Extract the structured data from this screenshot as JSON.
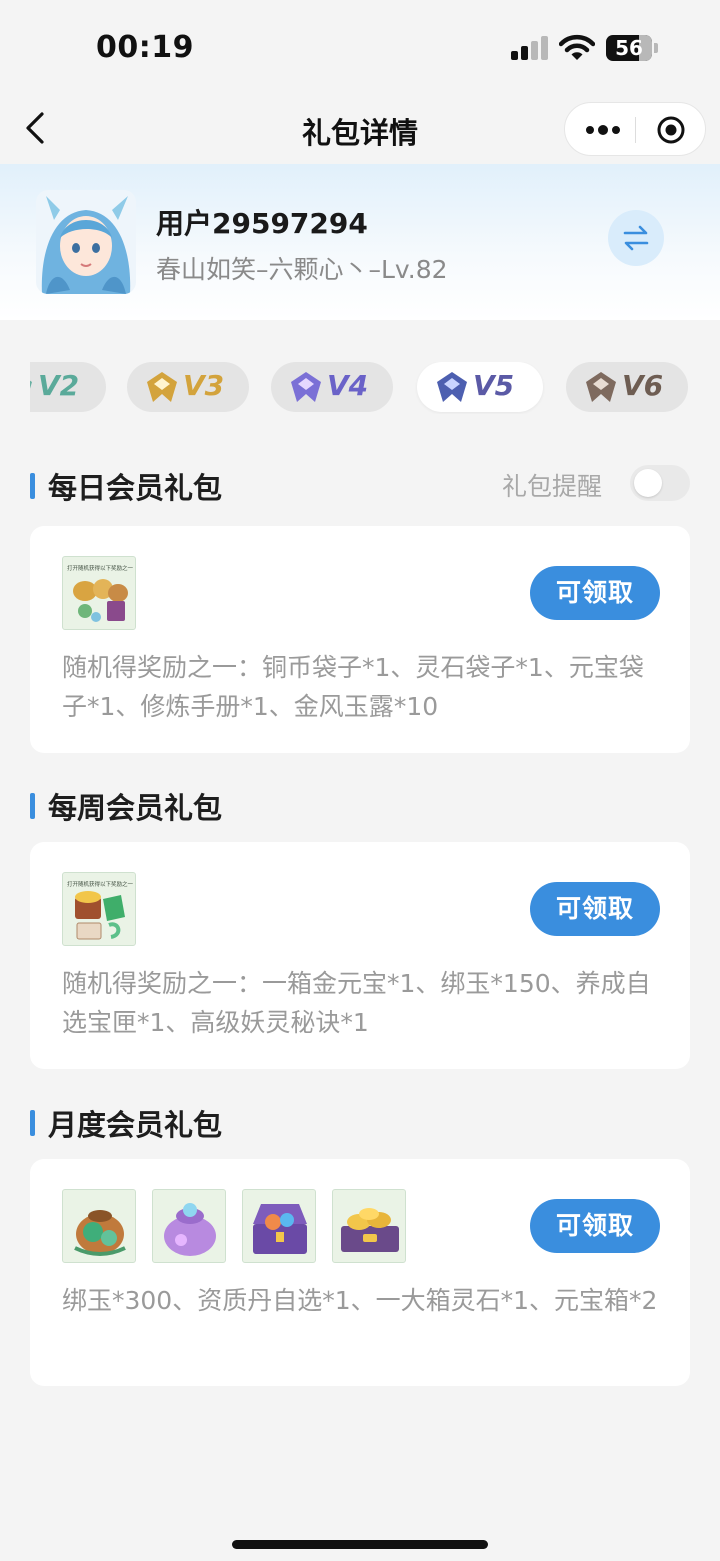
{
  "status_bar": {
    "time": "00:19",
    "battery": "56"
  },
  "nav": {
    "title": "礼包详情"
  },
  "user": {
    "name": "用户29597294",
    "server_role": "春山如笑–六颗心丶–Lv.82"
  },
  "levels": [
    {
      "label": "V2",
      "color": "#5aaa9a"
    },
    {
      "label": "V3",
      "color": "#d3a33c"
    },
    {
      "label": "V4",
      "color": "#6a62c8"
    },
    {
      "label": "V5",
      "color": "#5b5aa6",
      "selected": true
    },
    {
      "label": "V6",
      "color": "#6e5d52"
    }
  ],
  "sections": {
    "daily": {
      "title": "每日会员礼包",
      "remind_label": "礼包提醒",
      "remind_on": false,
      "icon_caption": "打开随机获得以下奖励之一",
      "claim_label": "可领取",
      "description": "随机得奖励之一：铜币袋子*1、灵石袋子*1、元宝袋子*1、修炼手册*1、金风玉露*10"
    },
    "weekly": {
      "title": "每周会员礼包",
      "icon_caption": "打开随机获得以下奖励之一",
      "claim_label": "可领取",
      "description": "随机得奖励之一：一箱金元宝*1、绑玉*150、养成自选宝匣*1、高级妖灵秘诀*1"
    },
    "monthly": {
      "title": "月度会员礼包",
      "claim_label": "可领取",
      "description": "绑玉*300、资质丹自选*1、一大箱灵石*1、元宝箱*2"
    }
  },
  "colors": {
    "accent": "#3a8ede",
    "page_bg": "#f4f4f4",
    "muted_text": "#9a9a9a"
  }
}
